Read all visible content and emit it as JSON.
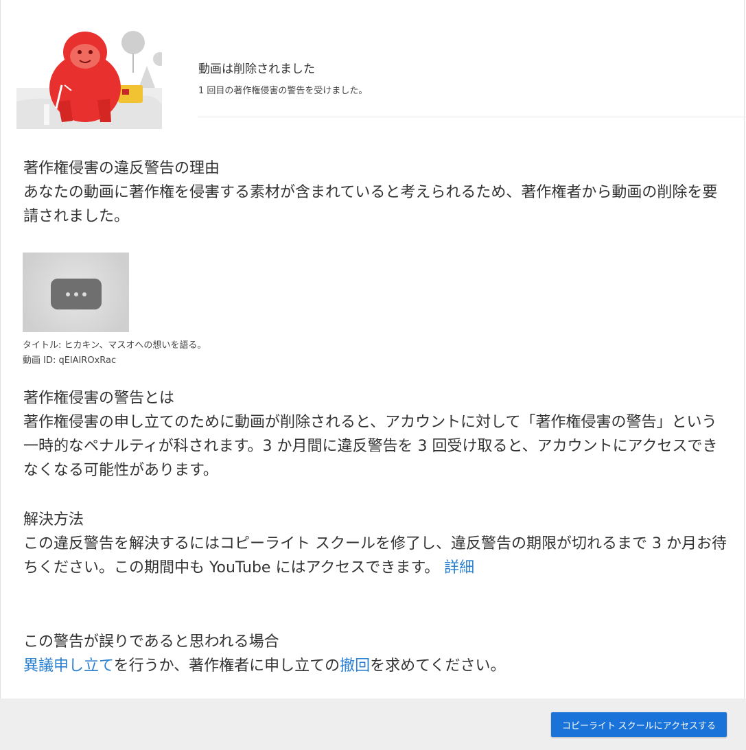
{
  "header": {
    "title": "動画は削除されました",
    "subtitle": "1 回目の著作権侵害の警告を受けました。"
  },
  "reason": {
    "title": "著作権侵害の違反警告の理由",
    "body": "あなたの動画に著作権を侵害する素材が含まれていると考えられるため、著作権者から動画の削除を要請されました。"
  },
  "video": {
    "title_line": "タイトル: ヒカキン、マスオへの想いを語る。",
    "id_line": "動画 ID: qElAIROxRac"
  },
  "about_strike": {
    "title": "著作権侵害の警告とは",
    "body": "著作権侵害の申し立てのために動画が削除されると、アカウントに対して「著作権侵害の警告」という一時的なペナルティが科されます。3 か月間に違反警告を 3 回受け取ると、アカウントにアクセスできなくなる可能性があります。"
  },
  "resolve": {
    "title": "解決方法",
    "body": "この違反警告を解決するにはコピーライト スクールを修了し、違反警告の期限が切れるまで 3 か月お待ちください。この期間中も YouTube にはアクセスできます。",
    "link": "詳細"
  },
  "mistake": {
    "title": "この警告が誤りであると思われる場合",
    "link1": "異議申し立て",
    "text1": "を行うか、著作権者に申し立ての",
    "link2": "撤回",
    "text2": "を求めてください。"
  },
  "footer": {
    "button_label": "コピーライト スクールにアクセスする"
  },
  "colors": {
    "link": "#2a7fcf",
    "button": "#1a73d9",
    "mascot": "#e8312f"
  }
}
